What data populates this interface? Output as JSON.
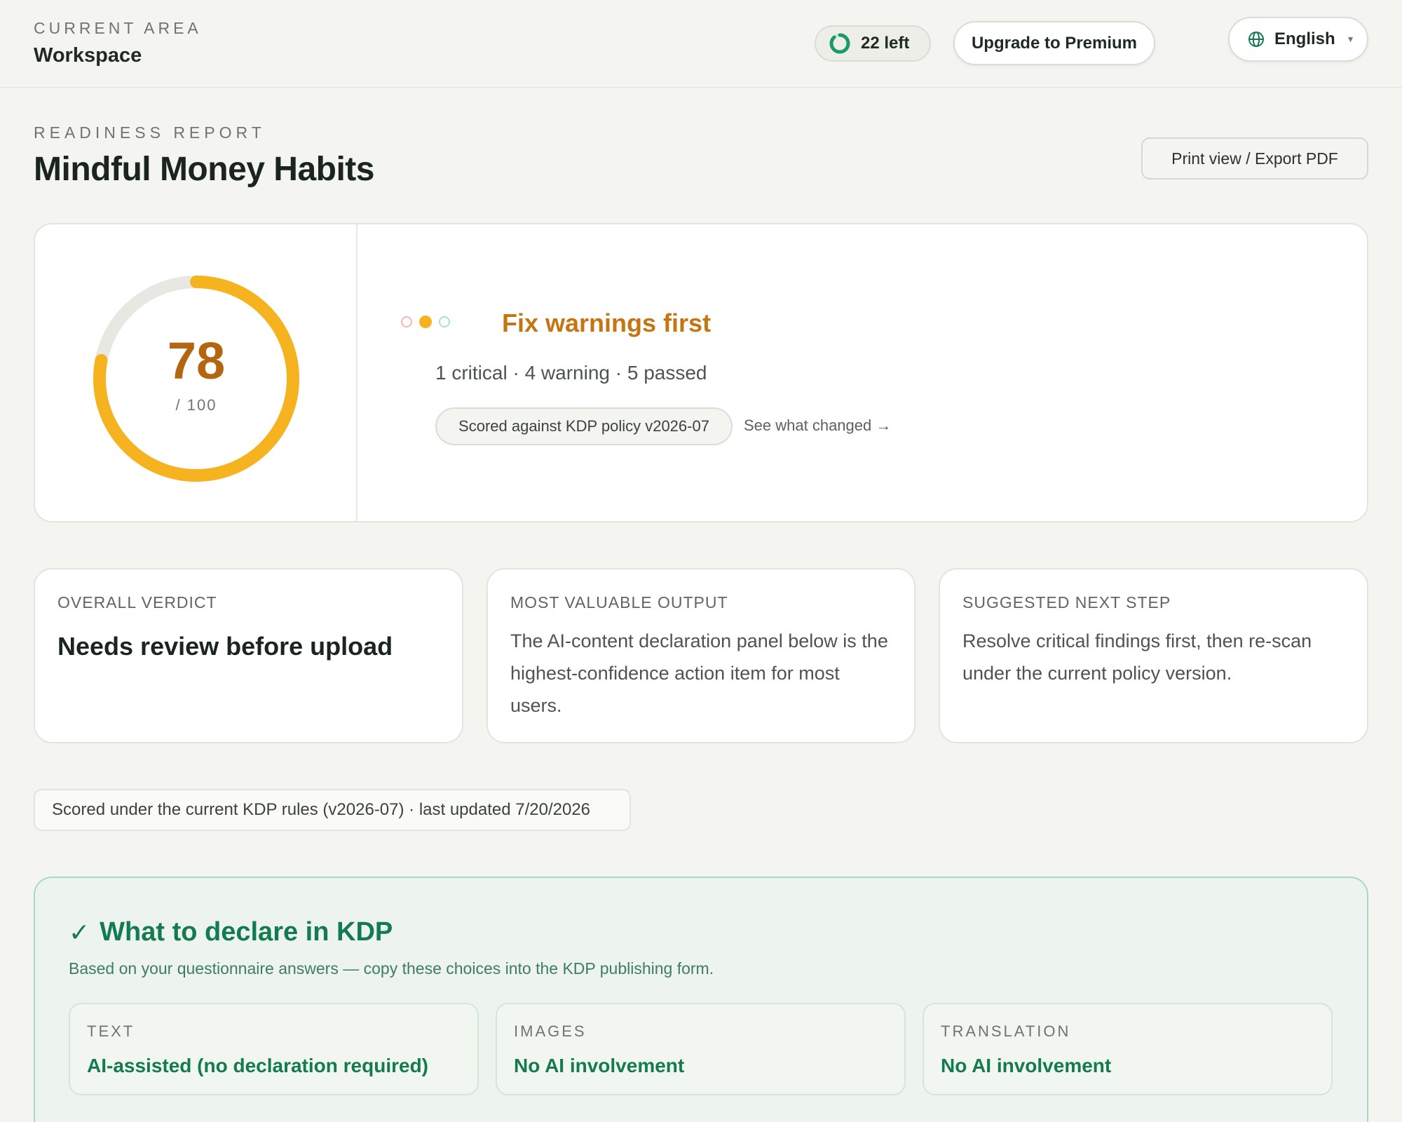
{
  "topbar": {
    "area_label": "CURRENT AREA",
    "area_value": "Workspace",
    "credits": "22 left",
    "credits_remaining_fraction": 0.88,
    "upgrade_label": "Upgrade to Premium",
    "language": "English",
    "icons": {
      "credits": "progress-ring-icon",
      "language": "globe-icon",
      "caret": "chevron-down-icon"
    }
  },
  "report": {
    "eyebrow": "READINESS REPORT",
    "title": "Mindful Money Habits",
    "print_label": "Print view / Export PDF"
  },
  "score": {
    "value": "78",
    "max": "/ 100",
    "status_title": "Fix warnings first",
    "counts": "1 critical · 4 warning · 5 passed",
    "policy": "Scored against KDP policy v2026-07",
    "changes_link": "See what changed →",
    "colors": {
      "gauge": "#f5b41f",
      "track": "#e8e8e3",
      "number": "#b4650f",
      "status": "#c57512"
    }
  },
  "summary": {
    "verdict_label": "OVERALL VERDICT",
    "verdict_value": "Needs review before upload",
    "output_label": "MOST VALUABLE OUTPUT",
    "output_body": "The AI-content declaration panel below is the highest-confidence action item for most users.",
    "next_label": "SUGGESTED NEXT STEP",
    "next_body": "Resolve critical findings first, then re-scan under the current policy version."
  },
  "scored_note": "Scored under the current KDP rules (v2026-07) · last updated 7/20/2026",
  "declare": {
    "check": "✓",
    "title": "What to declare in KDP",
    "subtitle": "Based on your questionnaire answers — copy these choices into the KDP publishing form.",
    "items": [
      {
        "label": "TEXT",
        "value": "AI-assisted (no declaration required)"
      },
      {
        "label": "IMAGES",
        "value": "No AI involvement"
      },
      {
        "label": "TRANSLATION",
        "value": "No AI involvement"
      }
    ],
    "colors": {
      "accent": "#147a50",
      "border": "#a8d9c2",
      "background": "#edf3ee"
    }
  }
}
